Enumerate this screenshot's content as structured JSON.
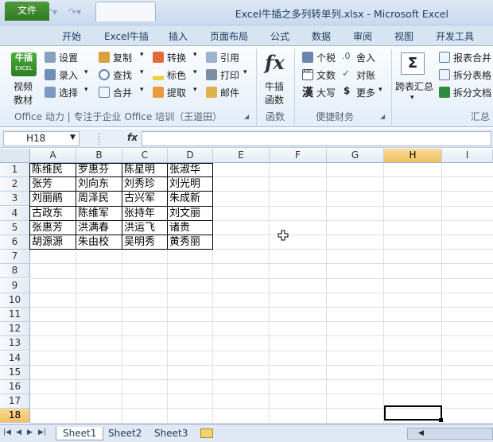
{
  "window": {
    "title": "Excel牛插之多列转单列.xlsx - Microsoft Excel"
  },
  "tabs": [
    "文件",
    "开始",
    "Excel牛插",
    "插入",
    "页面布局",
    "公式",
    "数据",
    "审阅",
    "视图",
    "开发工具"
  ],
  "ribbon": {
    "logo_line1": "牛插",
    "logo_line2": "EXCEL",
    "video_line1": "视频",
    "video_line2": "教材",
    "col1": [
      "设置",
      "录入",
      "选择"
    ],
    "col2": [
      "复制",
      "查找",
      "合并"
    ],
    "col3": [
      "转换",
      "标色",
      "提取"
    ],
    "col4": [
      "引用",
      "打印",
      "邮件"
    ],
    "group1_label": "Office 动力 | 专注于企业 Office 培训（王道田）",
    "fx_line1": "牛插",
    "fx_line2": "函数",
    "group2_label": "函数",
    "col5": [
      "个税",
      "文数",
      "大写"
    ],
    "col6": [
      "舍入",
      "对账",
      "更多"
    ],
    "group3_label": "便捷财务",
    "col7": "跨表汇总",
    "col8": [
      "报表合并",
      "拆分表格",
      "拆分文档"
    ],
    "group4_label": "汇总"
  },
  "formula_bar": {
    "name_box": "H18",
    "fx": "fx",
    "content": ""
  },
  "columns": [
    "A",
    "B",
    "C",
    "D",
    "E",
    "F",
    "G",
    "H",
    "I"
  ],
  "rows": [
    "1",
    "2",
    "3",
    "4",
    "5",
    "6",
    "7",
    "8",
    "9",
    "10",
    "11",
    "12",
    "13",
    "14",
    "15",
    "16",
    "17",
    "18"
  ],
  "selected": {
    "column": "H",
    "row": "18"
  },
  "cells": [
    [
      "陈维民",
      "罗惠芬",
      "陈星明",
      "张淑华"
    ],
    [
      "张芳",
      "刘向东",
      "刘秀珍",
      "刘光明"
    ],
    [
      "刘丽鹃",
      "周泽民",
      "古兴军",
      "朱成新"
    ],
    [
      "古政东",
      "陈维军",
      "张持年",
      "刘文丽"
    ],
    [
      "张惠芳",
      "洪满春",
      "洪运飞",
      "诸贵"
    ],
    [
      "胡源源",
      "朱由校",
      "吴明秀",
      "黄秀丽"
    ]
  ],
  "sheets": [
    "Sheet1",
    "Sheet2",
    "Sheet3"
  ]
}
